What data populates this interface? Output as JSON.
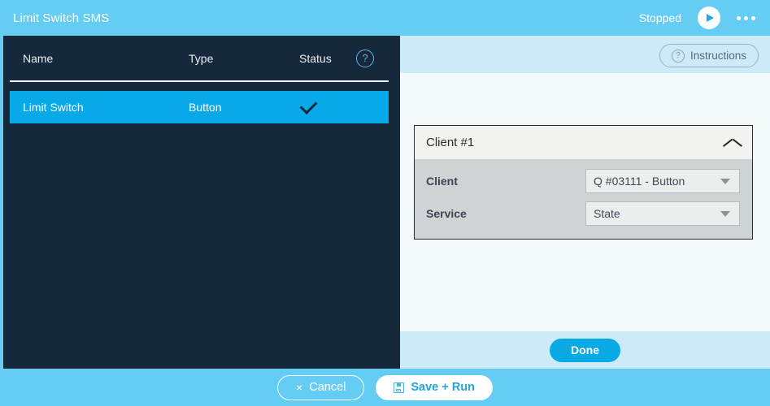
{
  "titlebar": {
    "title": "Limit Switch SMS",
    "status": "Stopped",
    "play_icon": "play-icon",
    "menu_icon": "kebab-menu-icon"
  },
  "list_panel": {
    "columns": [
      "Name",
      "Type",
      "Status"
    ],
    "help_icon": "?",
    "rows": [
      {
        "name": "Limit Switch",
        "type": "Button",
        "status_icon": "check-icon",
        "selected": true
      }
    ]
  },
  "detail_panel": {
    "instructions_button": {
      "label": "Instructions",
      "icon": "?"
    },
    "card": {
      "title": "Client #1",
      "collapse_icon": "chevron-up-icon",
      "fields": [
        {
          "label": "Client",
          "value": "Q #03111 - Button"
        },
        {
          "label": "Service",
          "value": "State"
        }
      ]
    },
    "done_label": "Done"
  },
  "footer": {
    "cancel_label": "Cancel",
    "cancel_icon": "×",
    "save_run_label": "Save + Run",
    "save_icon": "floppy-disk-icon"
  },
  "colors": {
    "title_bar": "#65cdf4",
    "panel_dark": "#16283c",
    "row_selected": "#07a9e8",
    "accent": "#09a9e6",
    "band_light": "#cdeaf8",
    "card_body": "#d0d3d6"
  }
}
